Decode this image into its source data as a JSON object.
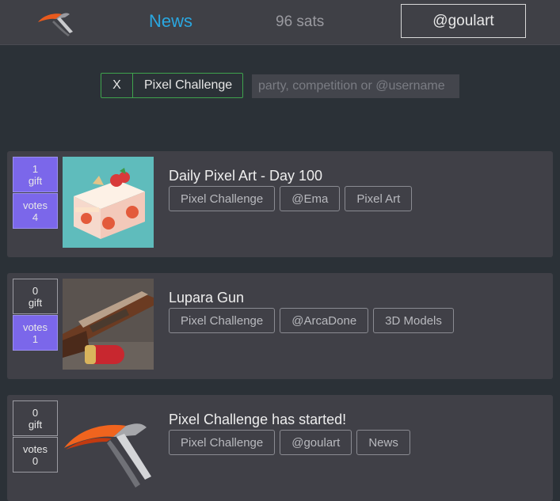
{
  "header": {
    "logo_icon": "app-logo",
    "nav_news": "News",
    "balance": "96 sats",
    "username": "@goulart"
  },
  "filter": {
    "clear_label": "X",
    "active_tag": "Pixel Challenge",
    "search_placeholder": "party, competition or @username"
  },
  "posts": [
    {
      "title": "Daily Pixel Art - Day 100",
      "gift_count": "1",
      "gift_label": "gift",
      "votes_label": "votes",
      "votes_count": "4",
      "gift_active": true,
      "votes_active": true,
      "thumbnail": "strawberry-cake-pixel-art",
      "tags": [
        "Pixel Challenge",
        "@Ema",
        "Pixel Art"
      ]
    },
    {
      "title": "Lupara Gun",
      "gift_count": "0",
      "gift_label": "gift",
      "votes_label": "votes",
      "votes_count": "1",
      "gift_active": false,
      "votes_active": true,
      "thumbnail": "shotgun-3d-model",
      "tags": [
        "Pixel Challenge",
        "@ArcaDone",
        "3D Models"
      ]
    },
    {
      "title": "Pixel Challenge has started!",
      "gift_count": "0",
      "gift_label": "gift",
      "votes_label": "votes",
      "votes_count": "0",
      "gift_active": false,
      "votes_active": false,
      "thumbnail": "app-logo",
      "tags": [
        "Pixel Challenge",
        "@goulart",
        "News"
      ]
    }
  ],
  "colors": {
    "accent": "#2aa7e0",
    "vote_active": "#7b67ea",
    "filter_border": "#3fa34d"
  }
}
